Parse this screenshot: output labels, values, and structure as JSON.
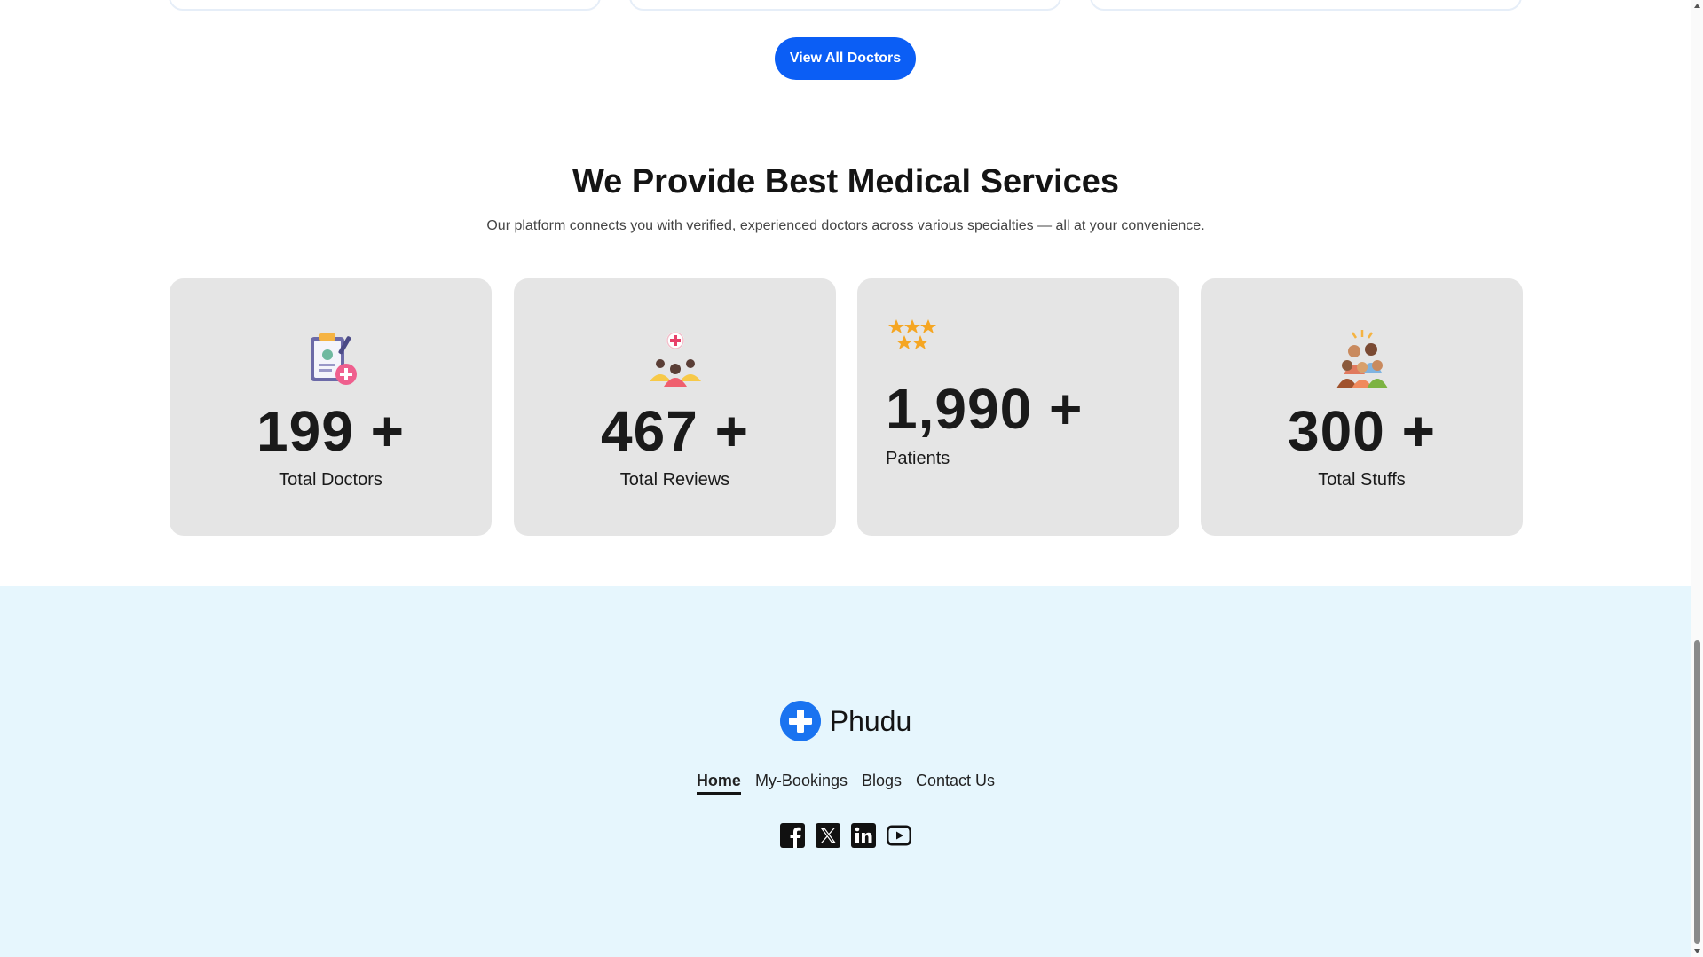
{
  "top_button": {
    "label": "View All Doctors"
  },
  "services": {
    "title": "We Provide Best Medical Services",
    "subtitle": "Our platform connects you with verified, experienced doctors across various specialties — all at your convenience."
  },
  "stats": [
    {
      "number": "199 +",
      "label": "Total Doctors",
      "icon": "doctor-report-icon"
    },
    {
      "number": "467 +",
      "label": "Total Reviews",
      "icon": "reviews-people-icon"
    },
    {
      "number": "1,990 +",
      "label": "Patients",
      "icon": "stars-icon"
    },
    {
      "number": "300 +",
      "label": "Total Stuffs",
      "icon": "staff-group-icon"
    }
  ],
  "footer": {
    "brand": "Phudu",
    "nav": [
      "Home",
      "My-Bookings",
      "Blogs",
      "Contact Us"
    ],
    "active_nav": "Home",
    "socials": [
      "facebook-icon",
      "x-icon",
      "linkedin-icon",
      "youtube-icon"
    ]
  },
  "colors": {
    "primary": "#0b5ef5",
    "card": "#e5e5e5",
    "footer_bg": "#e6f6fd"
  }
}
